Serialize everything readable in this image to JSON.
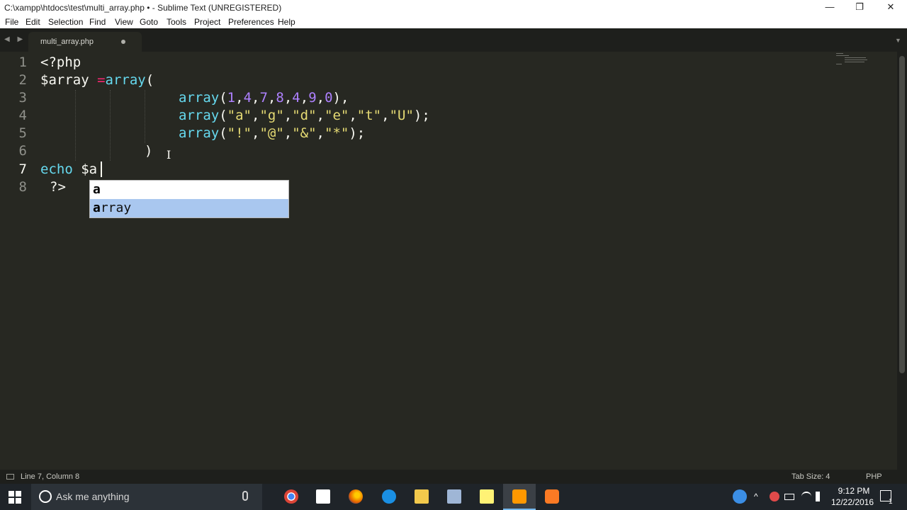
{
  "window": {
    "title": "C:\\xampp\\htdocs\\test\\multi_array.php • - Sublime Text (UNREGISTERED)",
    "minimize_glyph": "—",
    "restore_glyph": "❐",
    "close_glyph": "✕"
  },
  "menu": {
    "items": [
      "File",
      "Edit",
      "Selection",
      "Find",
      "View",
      "Goto",
      "Tools",
      "Project",
      "Preferences",
      "Help"
    ]
  },
  "tabs": {
    "nav_glyph": "◀ ▶",
    "active_tab": "multi_array.php",
    "dropdown_glyph": "▼"
  },
  "editor": {
    "line_numbers": [
      "1",
      "2",
      "3",
      "4",
      "5",
      "6",
      "7",
      "8"
    ],
    "active_line": "7",
    "lines": {
      "l1": "<?php",
      "l2_var": "$array ",
      "l2_op": "=",
      "l2_fn": "array",
      "l2_paren": "(",
      "l3_fn": "array",
      "l3_open": "(",
      "l3_nums": [
        "1",
        "4",
        "7",
        "8",
        "4",
        "9",
        "0"
      ],
      "l3_close": "),",
      "l4_fn": "array",
      "l4_open": "(",
      "l4_strs": [
        "\"a\"",
        "\"g\"",
        "\"d\"",
        "\"e\"",
        "\"t\"",
        "\"U\""
      ],
      "l4_close": ");",
      "l5_fn": "array",
      "l5_open": "(",
      "l5_strs": [
        "\"!\"",
        "\"@\"",
        "\"&\"",
        "\"*\""
      ],
      "l5_close": ");",
      "l6": ")",
      "l7_kw": "echo ",
      "l7_var": "$a",
      "l8": "?>"
    }
  },
  "autocomplete": {
    "items": [
      {
        "match": "a",
        "rest": ""
      },
      {
        "match": "a",
        "rest": "rray"
      }
    ]
  },
  "status": {
    "position": "Line 7, Column 8",
    "tab_size": "Tab Size: 4",
    "syntax": "PHP"
  },
  "taskbar": {
    "search_placeholder": "Ask me anything",
    "apps": [
      "chrome-icon",
      "store-icon",
      "firefox-icon",
      "edge-icon",
      "file-explorer-icon",
      "remote-desktop-icon",
      "sticky-notes-icon",
      "sublime-text-icon",
      "xampp-icon"
    ],
    "time": "9:12 PM",
    "date": "12/22/2016",
    "notification_count": "1"
  },
  "colors": {
    "editor_bg": "#272822",
    "keyword_blue": "#66d9ef",
    "operator_pink": "#f92672",
    "number_purple": "#ae81ff",
    "string_yellow": "#e6db74",
    "autocomplete_selected": "#a9c7ef"
  }
}
